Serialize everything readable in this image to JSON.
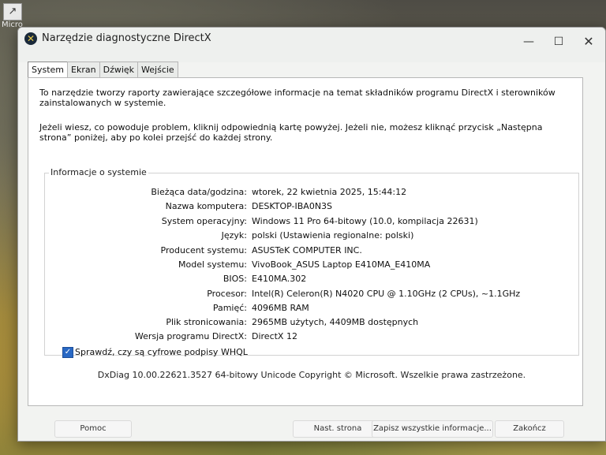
{
  "desktop": {
    "icon_label": "Micro"
  },
  "window": {
    "title": "Narzędzie diagnostyczne DirectX",
    "controls": {
      "minimize": "—",
      "maximize": "☐",
      "close": "✕"
    }
  },
  "tabs": [
    {
      "label": "System",
      "active": true
    },
    {
      "label": "Ekran",
      "active": false
    },
    {
      "label": "Dźwięk",
      "active": false
    },
    {
      "label": "Wejście",
      "active": false
    }
  ],
  "intro": {
    "paragraph1": "To narzędzie tworzy raporty zawierające szczegółowe informacje na temat składników programu DirectX i sterowników zainstalowanych w systemie.",
    "paragraph2": "Jeżeli wiesz, co powoduje problem, kliknij odpowiednią kartę powyżej. Jeżeli nie, możesz kliknąć przycisk „Następna strona” poniżej, aby po kolei przejść do każdej strony."
  },
  "system_info": {
    "group_title": "Informacje o systemie",
    "rows": [
      {
        "label": "Bieżąca data/godzina:",
        "value": "wtorek, 22 kwietnia 2025, 15:44:12"
      },
      {
        "label": "Nazwa komputera:",
        "value": "DESKTOP-IBA0N3S"
      },
      {
        "label": "System operacyjny:",
        "value": "Windows 11 Pro 64-bitowy (10.0, kompilacja 22631)"
      },
      {
        "label": "Język:",
        "value": "polski (Ustawienia regionalne: polski)"
      },
      {
        "label": "Producent systemu:",
        "value": "ASUSTeK COMPUTER INC."
      },
      {
        "label": "Model systemu:",
        "value": "VivoBook_ASUS Laptop E410MA_E410MA"
      },
      {
        "label": "BIOS:",
        "value": "E410MA.302"
      },
      {
        "label": "Procesor:",
        "value": "Intel(R) Celeron(R) N4020 CPU @ 1.10GHz (2 CPUs), ~1.1GHz"
      },
      {
        "label": "Pamięć:",
        "value": "4096MB RAM"
      },
      {
        "label": "Plik stronicowania:",
        "value": "2965MB użytych, 4409MB dostępnych"
      },
      {
        "label": "Wersja programu DirectX:",
        "value": "DirectX 12"
      }
    ]
  },
  "whql_check": {
    "label": "Sprawdź, czy są cyfrowe podpisy WHQL",
    "checked": true
  },
  "footer_text": "DxDiag 10.00.22621.3527 64-bitowy Unicode  Copyright © Microsoft. Wszelkie prawa zastrzeżone.",
  "buttons": {
    "help": "Pomoc",
    "next": "Nast. strona",
    "save": "Zapisz wszystkie informacje...",
    "exit": "Zakończ"
  }
}
